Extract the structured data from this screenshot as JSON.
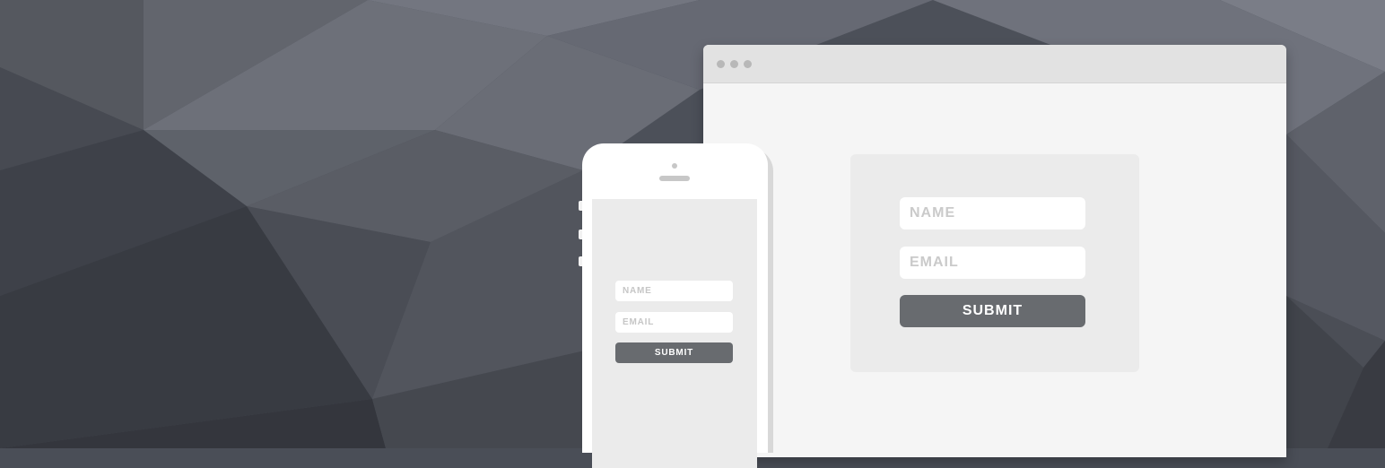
{
  "desktop_form": {
    "name_placeholder": "NAME",
    "email_placeholder": "EMAIL",
    "submit_label": "SUBMIT"
  },
  "mobile_form": {
    "name_placeholder": "NAME",
    "email_placeholder": "EMAIL",
    "submit_label": "SUBMIT"
  },
  "colors": {
    "background": "#4a4e57",
    "button": "#686b6f",
    "card": "#ebebeb",
    "browser_bar": "#e2e2e2"
  }
}
